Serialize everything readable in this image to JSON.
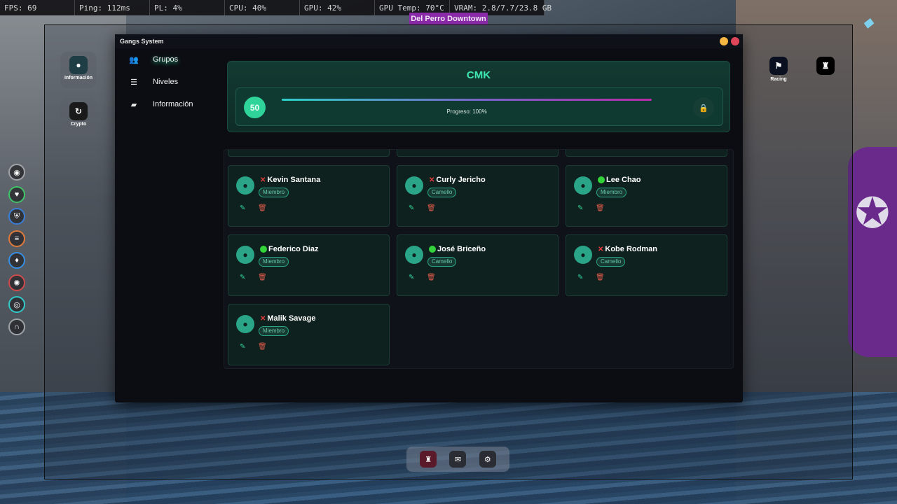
{
  "hud": [
    "FPS: 69",
    "Ping: 112ms",
    "PL: 4%",
    "CPU: 40%",
    "GPU: 42%",
    "GPU Temp: 70°C",
    "VRAM: 2.8/7.7/23.8 GB"
  ],
  "banner": "Del Perro Downtown",
  "left_apps": [
    {
      "label": "Información",
      "icon": "info-icon"
    },
    {
      "label": "Crypto",
      "icon": "crypto-icon"
    }
  ],
  "right_apps": [
    {
      "label": "Racing",
      "icon": "flag-icon"
    },
    {
      "label": "",
      "icon": "gang-icon"
    }
  ],
  "status_icons": [
    {
      "name": "voice-icon",
      "color": "#9fa3a8"
    },
    {
      "name": "health-icon",
      "color": "#3fc46a"
    },
    {
      "name": "armor-icon",
      "color": "#3a7ed8"
    },
    {
      "name": "hunger-icon",
      "color": "#e07a3a"
    },
    {
      "name": "thirst-icon",
      "color": "#3a8ee0"
    },
    {
      "name": "stress-icon",
      "color": "#d04a4a"
    },
    {
      "name": "eye-icon",
      "color": "#33c9c9"
    },
    {
      "name": "seatbelt-icon",
      "color": "#9fa3a8"
    }
  ],
  "window": {
    "title": "Gangs System",
    "nav": [
      {
        "label": "Grupos",
        "icon": "users-icon",
        "active": true
      },
      {
        "label": "Niveles",
        "icon": "list-icon",
        "active": false
      },
      {
        "label": "Información",
        "icon": "folder-star-icon",
        "active": false
      }
    ]
  },
  "gang": {
    "name": "CMK",
    "level": "50",
    "progress": 1.0,
    "progress_text": "Progreso: 100%"
  },
  "members": [
    {
      "name": "Kevin Santana",
      "role": "Miembro",
      "online": false
    },
    {
      "name": "Curly Jericho",
      "role": "Camello",
      "online": false
    },
    {
      "name": "Lee Chao",
      "role": "Miembro",
      "online": true
    },
    {
      "name": "Federico Diaz",
      "role": "Miembro",
      "online": true
    },
    {
      "name": "José Briceño",
      "role": "Camello",
      "online": true
    },
    {
      "name": "Kobe Rodman",
      "role": "Camello",
      "online": false
    },
    {
      "name": "Malik Savage",
      "role": "Miembro",
      "online": false
    }
  ],
  "colors": {
    "accent": "#2fd49a",
    "online": "#32d43a",
    "offline": "#e23b3b",
    "delete": "#e05a4a"
  },
  "dock": [
    {
      "icon": "gang-icon",
      "active": true
    },
    {
      "icon": "mail-icon",
      "active": false
    },
    {
      "icon": "settings-icon",
      "active": false
    }
  ]
}
